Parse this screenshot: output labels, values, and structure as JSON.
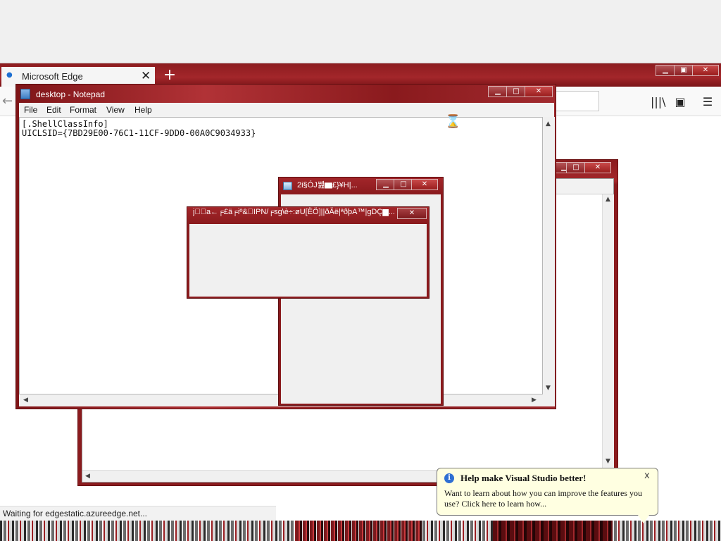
{
  "browser": {
    "tab_title": "Microsoft Edge",
    "tab_close": "✕",
    "new_tab": "+",
    "back_icon": "←",
    "window_controls": {
      "minimize": "▁",
      "maximize": "▣",
      "close": "✕"
    },
    "toolbar_icons": {
      "library": "|||\\",
      "sidebar": "▣",
      "menu": "☰"
    },
    "status_text": "Waiting for edgestatic.azureedge.net..."
  },
  "notepad": {
    "title": "desktop - Notepad",
    "menu": [
      "File",
      "Edit",
      "Format",
      "View",
      "Help"
    ],
    "content": "[.ShellClassInfo]\nUICLSID={7BD29E00-76C1-11CF-9DD0-00A0C9034933}",
    "controls": {
      "minimize": "▁",
      "maximize": "□",
      "close": "✕"
    }
  },
  "dialogs": {
    "tall_title": "2i§ÓJ쏊▆£}¥H|...",
    "wide_title": "j\u0000\u0000a←╒£ä╒iº&\u0000IPN/╒sg\\è÷:øU[ËÖ]||ðÄë|ªðþA™|gDÇ▆...",
    "controls": {
      "minimize": "▁",
      "maximize": "□",
      "close": "✕"
    }
  },
  "background_window": {
    "controls": {
      "minimize": "▁",
      "maximize": "□",
      "close": "✕"
    }
  },
  "toast": {
    "title": "Help make Visual Studio better!",
    "message": "Want to learn about how you can improve the features you use? Click here to learn how...",
    "close": "x",
    "info_icon": "i"
  },
  "colors": {
    "accent_red": "#9a2226",
    "toast_bg": "#ffffe1"
  }
}
